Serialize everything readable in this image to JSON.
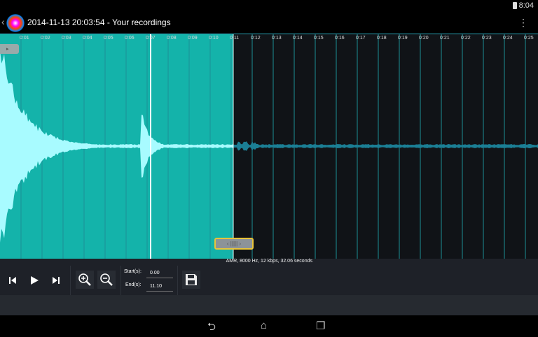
{
  "status": {
    "time": "8:04"
  },
  "action_bar": {
    "title": "2014-11-13 20:03:54 - Your recordings",
    "menu_icon": "overflow-menu-icon"
  },
  "waveform": {
    "ticks": [
      "0:01",
      "0:02",
      "0:03",
      "0:04",
      "0:05",
      "0:06",
      "0:07",
      "0:08",
      "0:09",
      "0:10",
      "0:11",
      "0:12",
      "0:13",
      "0:14",
      "0:15",
      "0:16",
      "0:17",
      "0:18",
      "0:19",
      "0:20",
      "0:21",
      "0:22",
      "0:23",
      "0:24",
      "0:25"
    ],
    "selection_start_s": 0.0,
    "selection_end_s": 11.1,
    "playhead_s": 7.0,
    "selected_color": "#14b3aa",
    "unselected_color": "#101317"
  },
  "info": "AMR, 8000 Hz, 12 kbps, 32.06 seconds",
  "controls": {
    "start_label": "Start(s):",
    "start_value": "0.00",
    "end_label": "End(s):",
    "end_value": "11.10"
  }
}
